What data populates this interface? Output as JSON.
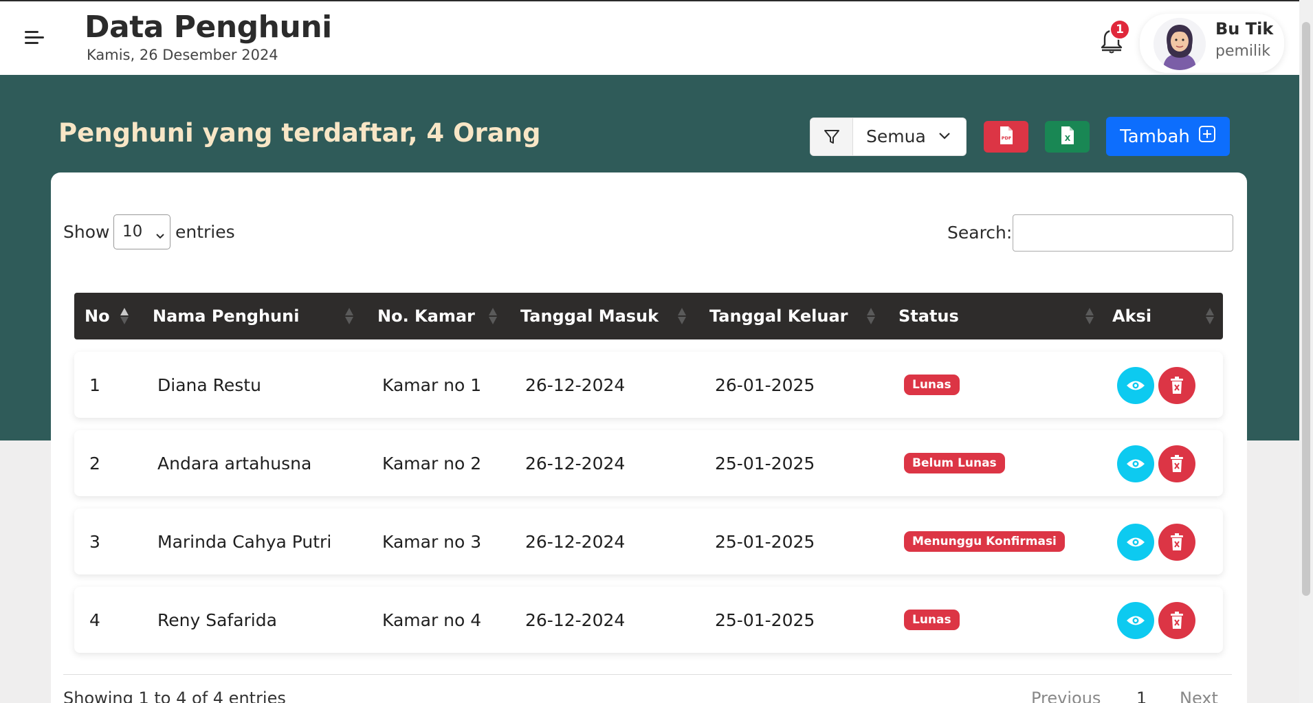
{
  "header": {
    "title": "Data Penghuni",
    "date": "Kamis, 26 Desember 2024",
    "notification_count": "1",
    "user_name": "Bu Tik",
    "user_role": "pemilik"
  },
  "toolbar": {
    "heading": "Penghuni yang terdaftar,  4 Orang",
    "filter_value": "Semua",
    "pdf_icon": "file-pdf-icon",
    "excel_icon": "file-excel-icon",
    "add_label": "Tambah"
  },
  "datatable": {
    "show_label": "Show",
    "entries_value": "10",
    "entries_label": "entries",
    "search_label": "Search:",
    "search_value": "",
    "columns": [
      "No",
      "Nama Penghuni",
      "No. Kamar",
      "Tanggal Masuk",
      "Tanggal Keluar",
      "Status",
      "Aksi"
    ],
    "rows": [
      {
        "no": "1",
        "nama": "Diana Restu",
        "kamar": "Kamar no 1",
        "masuk": "26-12-2024",
        "keluar": "26-01-2025",
        "status": "Lunas"
      },
      {
        "no": "2",
        "nama": "Andara artahusna",
        "kamar": "Kamar no 2",
        "masuk": "26-12-2024",
        "keluar": "25-01-2025",
        "status": "Belum Lunas"
      },
      {
        "no": "3",
        "nama": "Marinda Cahya Putri",
        "kamar": "Kamar no 3",
        "masuk": "26-12-2024",
        "keluar": "25-01-2025",
        "status": "Menunggu Konfirmasi"
      },
      {
        "no": "4",
        "nama": "Reny Safarida",
        "kamar": "Kamar no 4",
        "masuk": "26-12-2024",
        "keluar": "25-01-2025",
        "status": "Lunas"
      }
    ],
    "info": "Showing 1 to 4 of 4 entries",
    "pagination": {
      "previous": "Previous",
      "current": "1",
      "next": "Next"
    }
  },
  "colors": {
    "band": "#2f5b59",
    "heading": "#f8e6c6",
    "table_header": "#2e2c2b",
    "danger": "#dc3545",
    "info": "#0dcaf0",
    "primary": "#0d6efd",
    "success": "#198754"
  }
}
